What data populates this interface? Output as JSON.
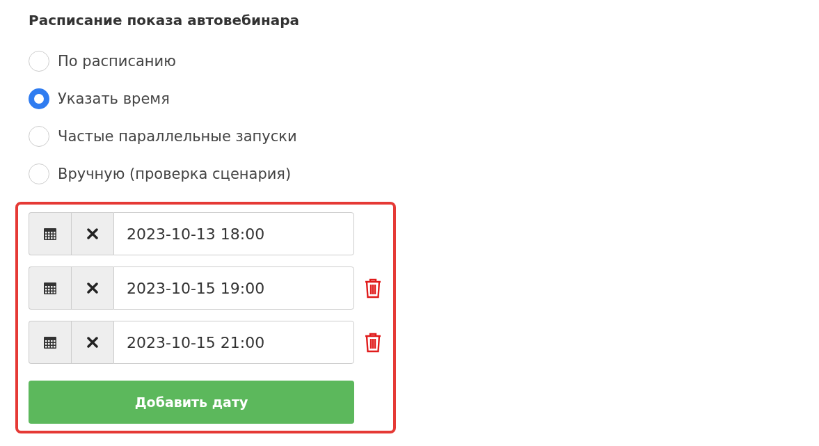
{
  "title": "Расписание показа автовебинара",
  "schedule_options": [
    {
      "label": "По расписанию",
      "selected": false
    },
    {
      "label": "Указать время",
      "selected": true
    },
    {
      "label": "Частые параллельные запуски",
      "selected": false
    },
    {
      "label": "Вручную (проверка сценария)",
      "selected": false
    }
  ],
  "dates": [
    {
      "value": "2023-10-13 18:00",
      "deletable": false
    },
    {
      "value": "2023-10-15 19:00",
      "deletable": true
    },
    {
      "value": "2023-10-15 21:00",
      "deletable": true
    }
  ],
  "add_button": "Добавить дату"
}
